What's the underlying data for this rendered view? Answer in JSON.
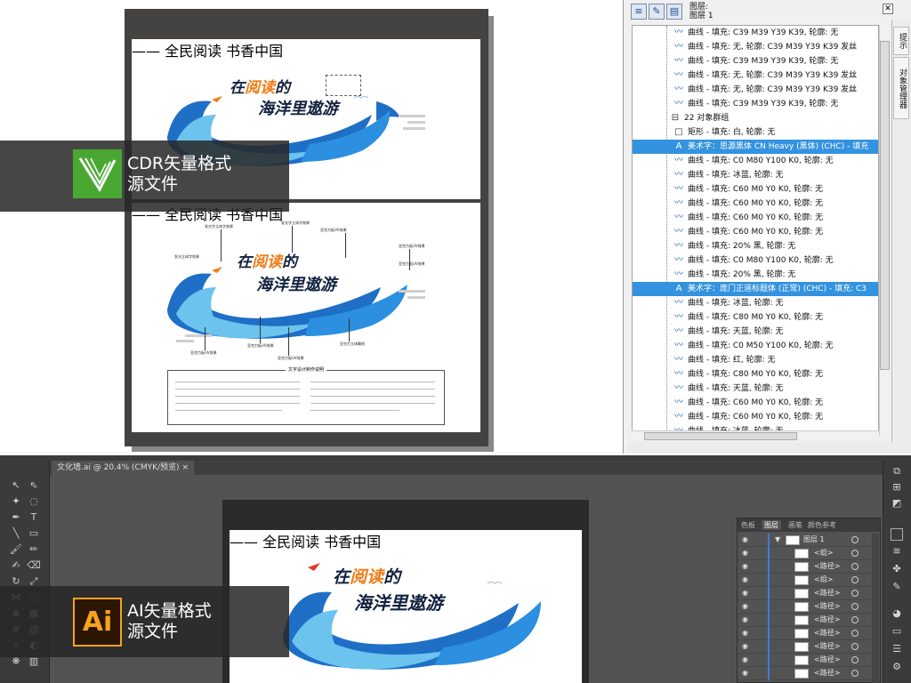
{
  "overlays": {
    "cdr": {
      "line1": "CDR矢量格式",
      "line2": "源文件"
    },
    "ai": {
      "logo": "Ai",
      "line1": "AI矢量格式",
      "line2": "源文件"
    }
  },
  "artwork": {
    "title_line1_a": "在",
    "title_line1_b": "阅读",
    "title_line1_c": "的",
    "title_line2": "海洋里遨游",
    "slogan": "—— 全民阅读  书香中国",
    "tip_title": "文字设计制作说明",
    "callouts": [
      "发光字立体字效果",
      "发光字立体字效果",
      "亚克力板UV效果",
      "发光立体字效果",
      "亚克力板UV效果",
      "亚克力板UV效果",
      "亚克力板UV效果",
      "亚克力板UV效果",
      "亚克力板UV效果",
      "亚克力立体雕刻"
    ]
  },
  "object_manager": {
    "layer_header": [
      "图层:",
      "图层 1"
    ],
    "rows": [
      {
        "icon": "curve-icon",
        "text": "曲线 - 填充: C39 M39 Y39 K39, 轮廓: 无",
        "selected": false
      },
      {
        "icon": "curve-icon",
        "text": "曲线 - 填充: 无, 轮廓: C39 M39 Y39 K39 发丝",
        "selected": false
      },
      {
        "icon": "curve-icon",
        "text": "曲线 - 填充: C39 M39 Y39 K39, 轮廓: 无",
        "selected": false
      },
      {
        "icon": "curve-icon",
        "text": "曲线 - 填充: 无, 轮廓: C39 M39 Y39 K39 发丝",
        "selected": false
      },
      {
        "icon": "curve-icon",
        "text": "曲线 - 填充: 无, 轮廓: C39 M39 Y39 K39 发丝",
        "selected": false
      },
      {
        "icon": "curve-icon",
        "text": "曲线 - 填充: C39 M39 Y39 K39, 轮廓: 无",
        "selected": false
      },
      {
        "icon": "group-icon",
        "text": "22 对象群组",
        "selected": false,
        "indent": "group"
      },
      {
        "icon": "rectangle-icon",
        "text": "矩形 - 填充: 白, 轮廓: 无",
        "selected": false
      },
      {
        "icon": "text-icon",
        "text": "美术字：思源黑体 CN Heavy (黑体) (CHC) - 填充",
        "selected": true
      },
      {
        "icon": "curve-icon",
        "text": "曲线 - 填充: C0 M80 Y100 K0, 轮廓: 无",
        "selected": false
      },
      {
        "icon": "curve-icon",
        "text": "曲线 - 填充: 冰蓝, 轮廓: 无",
        "selected": false
      },
      {
        "icon": "curve-icon",
        "text": "曲线 - 填充: C60 M0 Y0 K0, 轮廓: 无",
        "selected": false
      },
      {
        "icon": "curve-icon",
        "text": "曲线 - 填充: C60 M0 Y0 K0, 轮廓: 无",
        "selected": false
      },
      {
        "icon": "curve-icon",
        "text": "曲线 - 填充: C60 M0 Y0 K0, 轮廓: 无",
        "selected": false
      },
      {
        "icon": "curve-icon",
        "text": "曲线 - 填充: C60 M0 Y0 K0, 轮廓: 无",
        "selected": false
      },
      {
        "icon": "curve-icon",
        "text": "曲线 - 填充: 20% 黑, 轮廓: 无",
        "selected": false
      },
      {
        "icon": "curve-icon",
        "text": "曲线 - 填充: C0 M80 Y100 K0, 轮廓: 无",
        "selected": false
      },
      {
        "icon": "curve-icon",
        "text": "曲线 - 填充: 20% 黑, 轮廓: 无",
        "selected": false
      },
      {
        "icon": "text-icon",
        "text": "美术字：庞门正道标题体 (正常) (CHC) - 填充: C3",
        "selected": true
      },
      {
        "icon": "curve-icon",
        "text": "曲线 - 填充: 冰蓝, 轮廓: 无",
        "selected": false
      },
      {
        "icon": "curve-icon",
        "text": "曲线 - 填充: C80 M0 Y0 K0, 轮廓: 无",
        "selected": false
      },
      {
        "icon": "curve-icon",
        "text": "曲线 - 填充: 天蓝, 轮廓: 无",
        "selected": false
      },
      {
        "icon": "curve-icon",
        "text": "曲线 - 填充: C0 M50 Y100 K0, 轮廓: 无",
        "selected": false
      },
      {
        "icon": "curve-icon",
        "text": "曲线 - 填充: 红, 轮廓: 无",
        "selected": false
      },
      {
        "icon": "curve-icon",
        "text": "曲线 - 填充: C80 M0 Y0 K0, 轮廓: 无",
        "selected": false
      },
      {
        "icon": "curve-icon",
        "text": "曲线 - 填充: 天蓝, 轮廓: 无",
        "selected": false
      },
      {
        "icon": "curve-icon",
        "text": "曲线 - 填充: C60 M0 Y0 K0, 轮廓: 无",
        "selected": false
      },
      {
        "icon": "curve-icon",
        "text": "曲线 - 填充: C60 M0 Y0 K0, 轮廓: 无",
        "selected": false
      },
      {
        "icon": "curve-icon",
        "text": "曲线 - 填充: 冰蓝, 轮廓: 无",
        "selected": false
      }
    ],
    "side_tabs": [
      "提示",
      "对象管理器"
    ]
  },
  "illustrator": {
    "doc_tab": "文化墙.ai @ 20.4% (CMYK/预览)",
    "close_glyph": "×",
    "panel_tabs": [
      "色板",
      "图层",
      "画笔",
      "颜色参考"
    ],
    "layer_name": "图层 1",
    "sublayers": [
      "<组>",
      "<路径>",
      "<组>",
      "<路径>",
      "<路径>",
      "<路径>",
      "<路径>",
      "<路径>",
      "<路径>",
      "<路径>"
    ]
  },
  "colors": {
    "accent_selected": "#3393df",
    "wave_blue": "#1f6fc6",
    "light_blue": "#6cc3ee",
    "orange": "#ef7d18",
    "cdr_green": "#4aa832",
    "ai_orange": "#f7a21c"
  }
}
